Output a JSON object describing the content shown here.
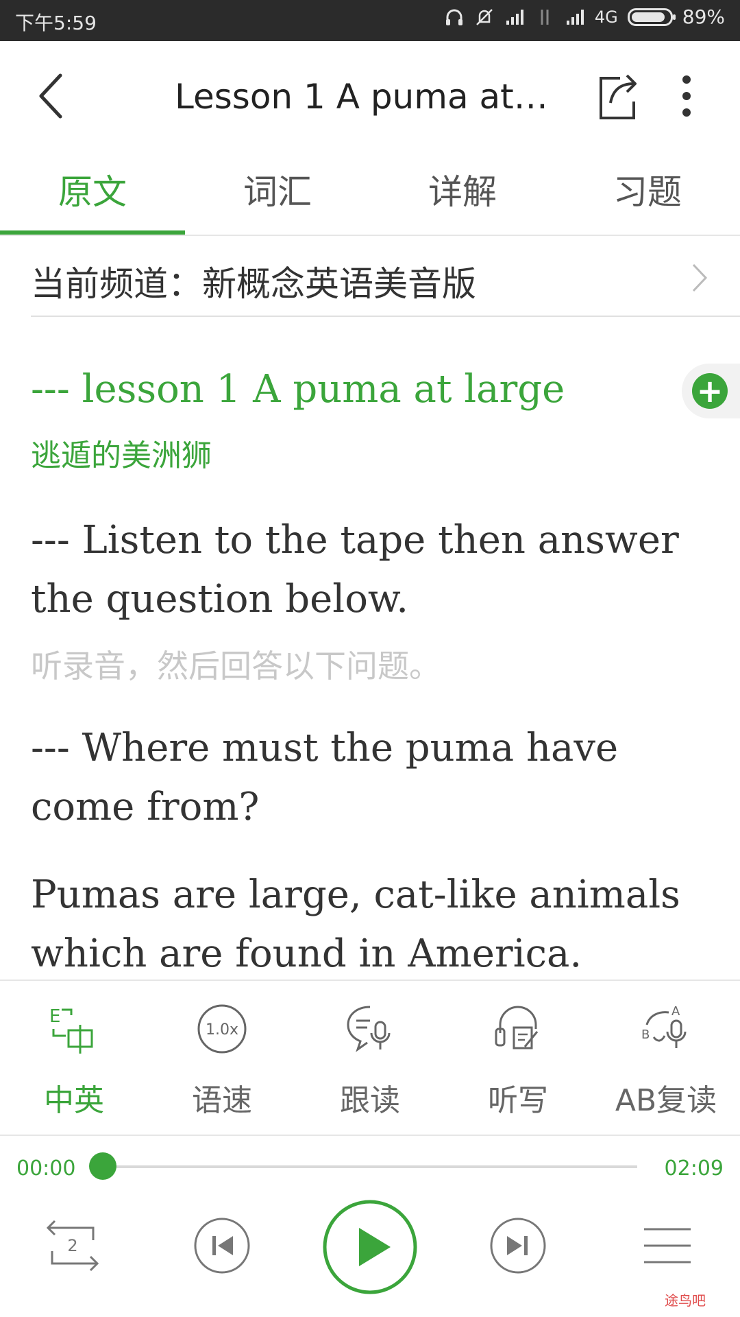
{
  "status_bar": {
    "time": "下午5:59",
    "network": "4G",
    "battery": "89%",
    "battery_level": 0.89
  },
  "header": {
    "title": "Lesson 1 A puma at…",
    "icons": [
      "back-icon",
      "share-icon",
      "more-icon"
    ]
  },
  "tabs": [
    {
      "label": "原文",
      "active": true
    },
    {
      "label": "词汇",
      "active": false
    },
    {
      "label": "详解",
      "active": false
    },
    {
      "label": "习题",
      "active": false
    }
  ],
  "channel": {
    "label": "当前频道：新概念英语美音版"
  },
  "content": {
    "lesson_title": "--- lesson 1  A puma at large",
    "lesson_subtitle": "逃遁的美洲狮",
    "para1_en": "--- Listen to the tape then answer the question below.",
    "para1_zh": "听录音，然后回答以下问题。",
    "para2_en": "--- Where must the puma have come from?",
    "para3_en": "Pumas are large, cat-like animals which are found in America."
  },
  "functions": [
    {
      "label": "中英",
      "icon": "cn-en-toggle-icon",
      "active": true
    },
    {
      "label": "语速",
      "icon": "speed-icon",
      "speed_text": "1.0x",
      "active": false
    },
    {
      "label": "跟读",
      "icon": "read-along-icon",
      "active": false
    },
    {
      "label": "听写",
      "icon": "dictation-icon",
      "active": false
    },
    {
      "label": "AB复读",
      "icon": "ab-repeat-icon",
      "active": false
    }
  ],
  "player": {
    "current_time": "00:00",
    "total_time": "02:09",
    "progress": 0.0,
    "repeat_count": "2"
  },
  "watermark": "途鸟吧",
  "colors": {
    "accent": "#3ba53b",
    "text": "#333333",
    "muted": "#c8c8c8",
    "statusbar": "#2b2b2b"
  }
}
